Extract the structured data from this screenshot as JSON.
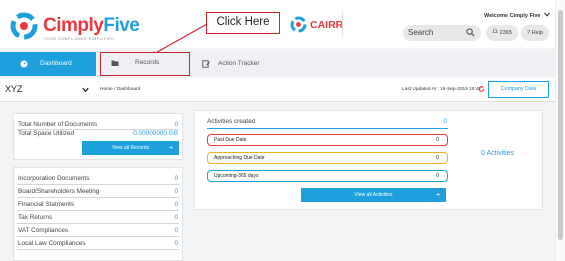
{
  "brand": {
    "name_part1": "Cimply",
    "name_part2": "Five",
    "tagline": "YOUR COMPLIANCE SIMPLIFIED",
    "red": "#e8383d",
    "blue": "#1ea0dc"
  },
  "callout": {
    "label": "Click Here"
  },
  "cairr": {
    "label": "CAIRR"
  },
  "header": {
    "search_label": "Search",
    "welcome": "Welcome Cimply  Five",
    "notif_count": "2365",
    "help_label": "Help"
  },
  "nav": {
    "dashboard": "Dashboard",
    "records": "Records",
    "action_tracker": "Action Tracker"
  },
  "subbar": {
    "company": "XYZ",
    "breadcrumb": "Home  /  Dashboard",
    "last_updated": "Last Updated At : 16-Sep-2019 15:47",
    "company_data_button": "Company Data"
  },
  "records_summary": {
    "total_docs_label": "Total Number of Documents",
    "total_docs_value": "0",
    "total_space_label": "Total Space Utilized",
    "total_space_value": "0.00000000 GB",
    "view_all_button": "View all Records"
  },
  "categories": [
    {
      "label": "Incorporation Documents",
      "value": "0"
    },
    {
      "label": "Board/Shareholders Meeting",
      "value": "0"
    },
    {
      "label": "Financial Statments",
      "value": "0"
    },
    {
      "label": "Tax Returns",
      "value": "0"
    },
    {
      "label": "VAT Compliances",
      "value": "0"
    },
    {
      "label": "Local Law Compliances",
      "value": "0"
    }
  ],
  "activities": {
    "title": "Activities created",
    "count": "0",
    "total": "0 Activities",
    "past_due": {
      "label": "Past Due Date",
      "value": "0",
      "color": "#e8383d"
    },
    "approaching": {
      "label": "Approaching Due Date",
      "value": "0",
      "color": "#f2b01e"
    },
    "upcoming": {
      "label": "Upcoming-365 days",
      "value": "0",
      "color": "#1ea0dc"
    },
    "view_all_button": "View all Activities"
  }
}
